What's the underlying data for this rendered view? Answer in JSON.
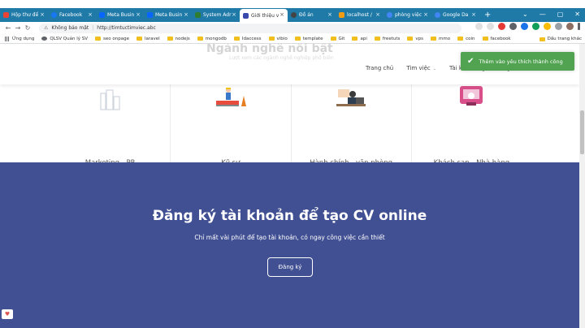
{
  "browser": {
    "tabs": [
      {
        "title": "Hộp thư đế",
        "color": "#ea4335"
      },
      {
        "title": "Facebook",
        "color": "#1877f2"
      },
      {
        "title": "Meta Busin",
        "color": "#0866ff"
      },
      {
        "title": "Meta Busin",
        "color": "#0866ff"
      },
      {
        "title": "System Adr",
        "color": "#2e7d32"
      },
      {
        "title": "Giới thiệu v",
        "color": "#3949ab",
        "active": true
      },
      {
        "title": "Đồ án",
        "color": "#444444"
      },
      {
        "title": "localhost /",
        "color": "#f39c12"
      },
      {
        "title": "phòng việc",
        "color": "#4285f4"
      },
      {
        "title": "Google Da",
        "color": "#4285f4"
      }
    ],
    "new_tab_label": "+",
    "address": {
      "security_label": "Không bảo mật",
      "url": "http://timtuctimviec.abc"
    },
    "bookmarks": [
      "Ứng dụng",
      "QLSV Quản lý SV",
      "seo onpage",
      "laravel",
      "nodejs",
      "mongodb",
      "Idaccess",
      "vibio",
      "template",
      "Git",
      "api",
      "freetuts",
      "vps",
      "mmo",
      "coin",
      "facebook"
    ],
    "bookmarks_right": "Dấu trang khác"
  },
  "site": {
    "header_title_ghost": "Ngành nghề nổi bật",
    "header_sub_ghost": "Lượt xem các ngành nghề nghiệp phổ biến",
    "menu": [
      {
        "label": "Trang chủ"
      },
      {
        "label": "Tìm việc",
        "caret": true
      },
      {
        "label": "Tài khoản người dùng",
        "caret": true
      }
    ],
    "toast": {
      "message": "Thêm vào yêu thích thành công",
      "color": "#51a351"
    },
    "categories": [
      {
        "label": "Marketing - PR",
        "icon": "building-icon"
      },
      {
        "label": "Kỹ sư",
        "icon": "engineer-icon"
      },
      {
        "label": "Hành chính - văn phòng",
        "icon": "office-worker-icon"
      },
      {
        "label": "Khách sạn - Nhà hàng",
        "icon": "hotel-bell-icon"
      }
    ],
    "signup": {
      "title": "Đăng ký tài khoản để tạo CV online",
      "subtitle": "Chỉ mất vài phút để tạo tài khoản, có ngay công việc cần thiết",
      "button": "Đăng ký",
      "background": "#414f93"
    }
  }
}
